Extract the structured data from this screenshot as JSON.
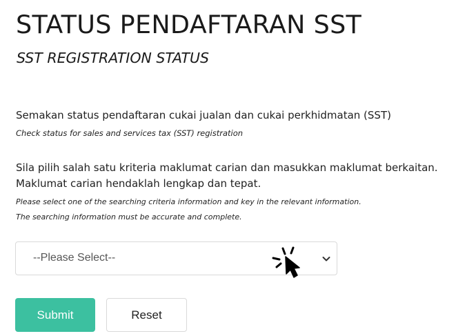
{
  "header": {
    "title": "STATUS PENDAFTARAN SST",
    "subtitle": "SST REGISTRATION STATUS"
  },
  "description": {
    "ms": "Semakan status pendaftaran cukai jualan dan cukai perkhidmatan (SST)",
    "en": "Check status for sales and services tax (SST) registration"
  },
  "instructions": {
    "ms_line1": "Sila pilih salah satu kriteria maklumat carian dan masukkan maklumat berkaitan.",
    "ms_line2": "Maklumat carian hendaklah lengkap dan tepat.",
    "en_line1": "Please select one of the searching criteria information and key in the relevant information.",
    "en_line2": "The searching information must be accurate and complete."
  },
  "form": {
    "criteria_select": {
      "selected": "--Please Select--",
      "icon": "chevron-down-icon"
    },
    "submit_label": "Submit",
    "reset_label": "Reset"
  },
  "overlay": {
    "icon": "click-cursor-icon"
  },
  "colors": {
    "accent": "#3cc0a0",
    "text": "#1f1f1f",
    "border": "#d9d9d9"
  }
}
